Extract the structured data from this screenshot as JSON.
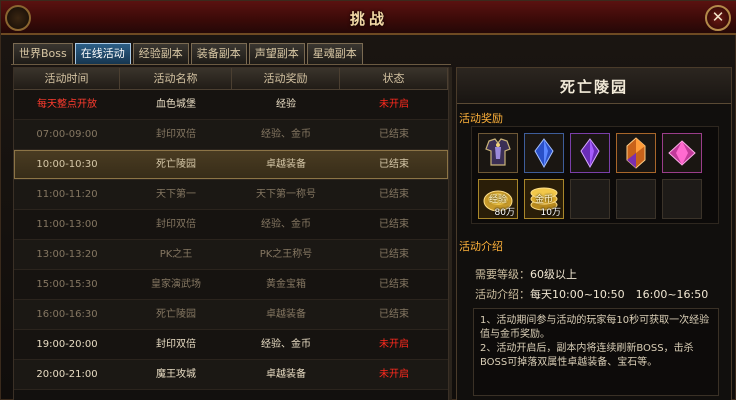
{
  "window": {
    "title": "挑战",
    "close_label": "✕"
  },
  "tabs": [
    {
      "label": "世界Boss",
      "active": false
    },
    {
      "label": "在线活动",
      "active": true
    },
    {
      "label": "经验副本",
      "active": false
    },
    {
      "label": "装备副本",
      "active": false
    },
    {
      "label": "声望副本",
      "active": false
    },
    {
      "label": "星魂副本",
      "active": false
    }
  ],
  "table": {
    "headers": [
      "活动时间",
      "活动名称",
      "活动奖励",
      "状态"
    ],
    "rows": [
      {
        "time": "每天整点开放",
        "name": "血色城堡",
        "reward": "经验",
        "status": "未开启"
      },
      {
        "time": "07:00-09:00",
        "name": "封印双倍",
        "reward": "经验、金币",
        "status": "已结束"
      },
      {
        "time": "10:00-10:30",
        "name": "死亡陵园",
        "reward": "卓越装备",
        "status": "已结束"
      },
      {
        "time": "11:00-11:20",
        "name": "天下第一",
        "reward": "天下第一称号",
        "status": "已结束"
      },
      {
        "time": "11:00-13:00",
        "name": "封印双倍",
        "reward": "经验、金币",
        "status": "已结束"
      },
      {
        "time": "13:00-13:20",
        "name": "PK之王",
        "reward": "PK之王称号",
        "status": "已结束"
      },
      {
        "time": "15:00-15:30",
        "name": "皇家演武场",
        "reward": "黄金宝箱",
        "status": "已结束"
      },
      {
        "time": "16:00-16:30",
        "name": "死亡陵园",
        "reward": "卓越装备",
        "status": "已结束"
      },
      {
        "time": "19:00-20:00",
        "name": "封印双倍",
        "reward": "经验、金币",
        "status": "未开启"
      },
      {
        "time": "20:00-21:00",
        "name": "魔王攻城",
        "reward": "卓越装备",
        "status": "未开启"
      }
    ]
  },
  "detail": {
    "title": "死亡陵园",
    "rewards_label": "活动奖励",
    "intro_label": "活动介绍",
    "reward_items": [
      {
        "icon": "armor-chest-icon",
        "qty": ""
      },
      {
        "icon": "blue-crystal-icon",
        "qty": ""
      },
      {
        "icon": "purple-crystal-icon",
        "qty": ""
      },
      {
        "icon": "orange-crystal-icon",
        "qty": ""
      },
      {
        "icon": "pink-gem-icon",
        "qty": ""
      },
      {
        "icon": "experience-icon",
        "label": "经验",
        "qty": "80万"
      },
      {
        "icon": "gold-coins-icon",
        "label": "金币",
        "qty": "10万"
      }
    ],
    "level_label": "需要等级：",
    "level_value": "60级以上",
    "time_label": "活动介绍：",
    "time_value": "每天10:00~10:50　16:00~16:50",
    "description": [
      "1、活动期间参与活动的玩家每10秒可获取一次经验值与金币奖励。",
      "2、活动开启后，副本内将连续刷新BOSS，击杀BOSS可掉落双属性卓越装备、宝石等。"
    ]
  },
  "colors": {
    "accent_gold": "#ffb23a",
    "status_red": "#ff2a1e",
    "active_tab": "#2c5e86",
    "title_bar": "#5a1210"
  }
}
